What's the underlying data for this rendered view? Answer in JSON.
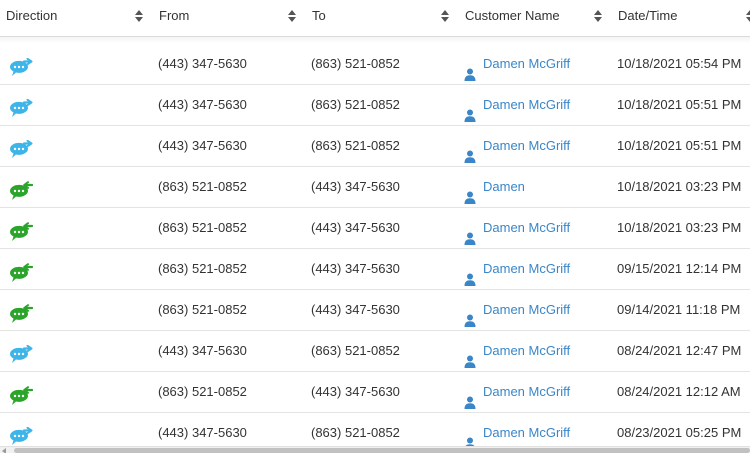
{
  "columns": [
    {
      "key": "direction",
      "label": "Direction"
    },
    {
      "key": "from",
      "label": "From"
    },
    {
      "key": "to",
      "label": "To"
    },
    {
      "key": "customer",
      "label": "Customer Name"
    },
    {
      "key": "datetime",
      "label": "Date/Time"
    }
  ],
  "colors": {
    "outbound": "#3db5e8",
    "inbound": "#2aa52a",
    "link": "#3a86c8"
  },
  "icons": {
    "outbound": "outbound-message-icon",
    "inbound": "inbound-message-icon",
    "customer": "person-icon",
    "sort": "sort-icon"
  },
  "rows": [
    {
      "direction": "outbound",
      "from": "(443) 347-5630",
      "to": "(863) 521-0852",
      "customer": "Damen McGriff",
      "datetime": "10/18/2021 05:54 PM"
    },
    {
      "direction": "outbound",
      "from": "(443) 347-5630",
      "to": "(863) 521-0852",
      "customer": "Damen McGriff",
      "datetime": "10/18/2021 05:51 PM"
    },
    {
      "direction": "outbound",
      "from": "(443) 347-5630",
      "to": "(863) 521-0852",
      "customer": "Damen McGriff",
      "datetime": "10/18/2021 05:51 PM"
    },
    {
      "direction": "inbound",
      "from": "(863) 521-0852",
      "to": "(443) 347-5630",
      "customer": "Damen",
      "datetime": "10/18/2021 03:23 PM"
    },
    {
      "direction": "inbound",
      "from": "(863) 521-0852",
      "to": "(443) 347-5630",
      "customer": "Damen McGriff",
      "datetime": "10/18/2021 03:23 PM"
    },
    {
      "direction": "inbound",
      "from": "(863) 521-0852",
      "to": "(443) 347-5630",
      "customer": "Damen McGriff",
      "datetime": "09/15/2021 12:14 PM"
    },
    {
      "direction": "inbound",
      "from": "(863) 521-0852",
      "to": "(443) 347-5630",
      "customer": "Damen McGriff",
      "datetime": "09/14/2021 11:18 PM"
    },
    {
      "direction": "outbound",
      "from": "(443) 347-5630",
      "to": "(863) 521-0852",
      "customer": "Damen McGriff",
      "datetime": "08/24/2021 12:47 PM"
    },
    {
      "direction": "inbound",
      "from": "(863) 521-0852",
      "to": "(443) 347-5630",
      "customer": "Damen McGriff",
      "datetime": "08/24/2021 12:12 AM"
    },
    {
      "direction": "outbound",
      "from": "(443) 347-5630",
      "to": "(863) 521-0852",
      "customer": "Damen McGriff",
      "datetime": "08/23/2021 05:25 PM"
    }
  ]
}
